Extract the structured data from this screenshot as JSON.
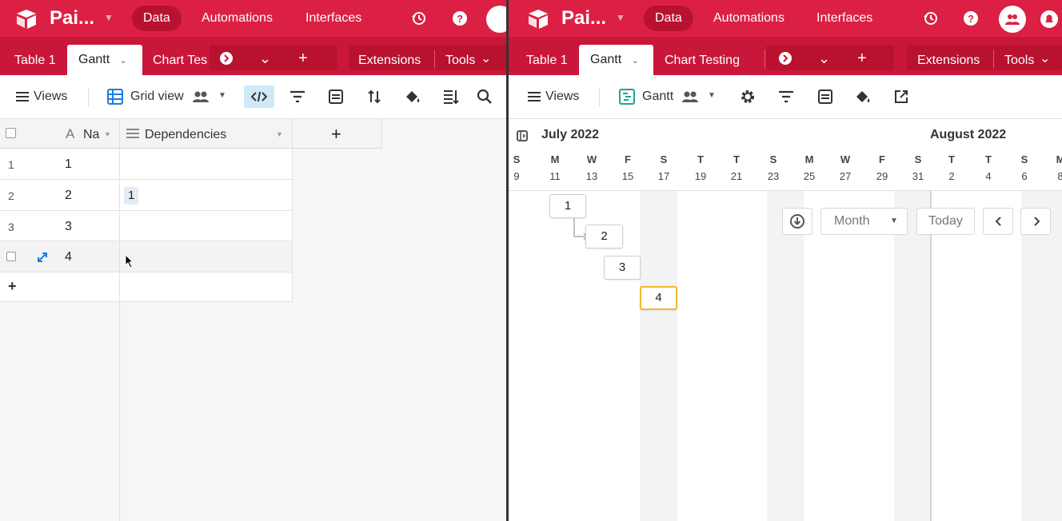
{
  "app": {
    "name": "Pai...",
    "nav": {
      "data": "Data",
      "automations": "Automations",
      "interfaces": "Interfaces"
    }
  },
  "colors": {
    "brand": "#dc2043",
    "tabbar": "#c9173a",
    "accent_blue": "#1f7ae0",
    "gantt_teal": "#1aa68f",
    "bar_selected": "#f5b82e"
  },
  "left": {
    "tabs": [
      "Table 1",
      "Gantt",
      "Chart Tes"
    ],
    "tabbar_right": {
      "extensions": "Extensions",
      "tools": "Tools"
    },
    "toolbar": {
      "views": "Views",
      "view_name": "Grid view"
    },
    "grid": {
      "columns": {
        "name": "Na",
        "dependencies": "Dependencies",
        "add": "+"
      },
      "rows": [
        {
          "num": "1",
          "name": "1",
          "dep": ""
        },
        {
          "num": "2",
          "name": "2",
          "dep": "1"
        },
        {
          "num": "3",
          "name": "3",
          "dep": ""
        },
        {
          "num": "",
          "name": "4",
          "dep": ""
        }
      ],
      "add_row": "+"
    }
  },
  "right": {
    "tabs": [
      "Table 1",
      "Gantt",
      "Chart Testing"
    ],
    "tabbar_right": {
      "extensions": "Extensions",
      "tools": "Tools"
    },
    "toolbar": {
      "views": "Views",
      "view_name": "Gantt"
    },
    "timeline": {
      "months": [
        "July 2022",
        "August 2022"
      ],
      "days": [
        {
          "d": "S",
          "n": "9"
        },
        {
          "d": "M",
          "n": "11"
        },
        {
          "d": "W",
          "n": "13"
        },
        {
          "d": "F",
          "n": "15"
        },
        {
          "d": "S",
          "n": "17"
        },
        {
          "d": "T",
          "n": "19"
        },
        {
          "d": "T",
          "n": "21"
        },
        {
          "d": "S",
          "n": "23"
        },
        {
          "d": "M",
          "n": "25"
        },
        {
          "d": "W",
          "n": "27"
        },
        {
          "d": "F",
          "n": "29"
        },
        {
          "d": "S",
          "n": "31"
        },
        {
          "d": "T",
          "n": "2"
        },
        {
          "d": "T",
          "n": "4"
        },
        {
          "d": "S",
          "n": "6"
        },
        {
          "d": "M",
          "n": "8"
        }
      ]
    },
    "controls": {
      "scale": "Month",
      "today": "Today"
    },
    "bars": [
      "1",
      "2",
      "3",
      "4"
    ],
    "selected_bar": "4"
  }
}
